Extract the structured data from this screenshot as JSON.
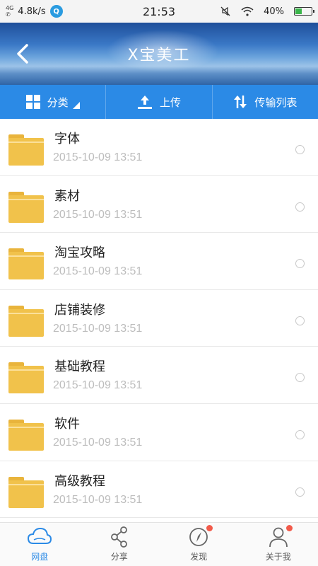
{
  "status_bar": {
    "network_1": "4G",
    "speed": "4.8k/s",
    "app_badge": "Q",
    "time": "21:53",
    "battery": "40%",
    "battery_level": 0.4
  },
  "header": {
    "back_icon": "chevron-left-icon",
    "title": "X宝美工"
  },
  "toolbar": {
    "category_label": "分类",
    "upload_label": "上传",
    "transfer_label": "传输列表"
  },
  "files": [
    {
      "name": "字体",
      "date": "2015-10-09  13:51"
    },
    {
      "name": "素材",
      "date": "2015-10-09  13:51"
    },
    {
      "name": "淘宝攻略",
      "date": "2015-10-09  13:51"
    },
    {
      "name": "店铺装修",
      "date": "2015-10-09  13:51"
    },
    {
      "name": "基础教程",
      "date": "2015-10-09  13:51"
    },
    {
      "name": "软件",
      "date": "2015-10-09  13:51"
    },
    {
      "name": "高级教程",
      "date": "2015-10-09  13:51"
    }
  ],
  "bottom_nav": [
    {
      "label": "网盘",
      "icon": "cloud-icon",
      "active": true,
      "badge": false
    },
    {
      "label": "分享",
      "icon": "share-icon",
      "active": false,
      "badge": false
    },
    {
      "label": "发现",
      "icon": "compass-icon",
      "active": false,
      "badge": true
    },
    {
      "label": "关于我",
      "icon": "person-icon",
      "active": false,
      "badge": true
    }
  ],
  "colors": {
    "accent": "#2b8ae6",
    "folder": "#f1c24b",
    "badge": "#f25a4a",
    "date_text": "#bdbdbd"
  }
}
